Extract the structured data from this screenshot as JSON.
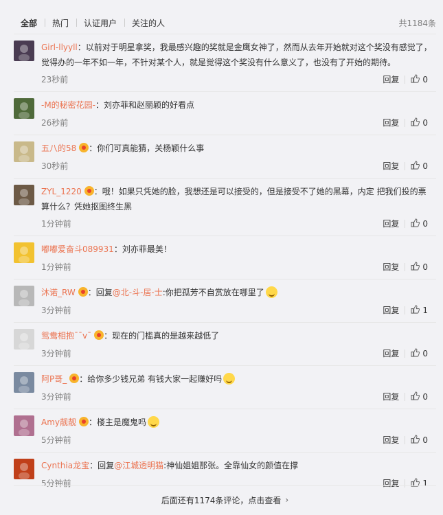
{
  "tabs": [
    "全部",
    "热门",
    "认证用户",
    "关注的人"
  ],
  "total": "共1184条",
  "actions": {
    "reply": "回复"
  },
  "comments": [
    {
      "user": "Girl-llyyll",
      "badge": false,
      "text": "：以前对于明星拿奖，我最感兴趣的奖就是金鹰女神了，然而从去年开始就对这个奖没有感觉了，觉得办的一年不如一年，不针对某个人，就是觉得这个奖没有什么意义了，也没有了开始的期待。",
      "time": "23秒前",
      "likes": "0",
      "avatar_color": "#4a3c52"
    },
    {
      "user": "-M的秘密花园-",
      "badge": false,
      "text": "：刘亦菲和赵丽颖的好看点",
      "time": "26秒前",
      "likes": "0",
      "avatar_color": "#4f6a3a"
    },
    {
      "user": "五八的58",
      "badge": true,
      "text": "：你们可真能猜，关杨颖什么事",
      "time": "30秒前",
      "likes": "0",
      "avatar_color": "#c9b98a"
    },
    {
      "user": "ZYL_1220",
      "badge": true,
      "text": "：哦！如果只凭她的脸，我想还是可以接受的，但是接受不了她的黑幕，内定 把我们投的票算什么？凭她抠图终生黑",
      "time": "1分钟前",
      "likes": "0",
      "avatar_color": "#6d5a46"
    },
    {
      "user": "嘟嘟爱奋斗089931",
      "badge": false,
      "text": "：刘亦菲最美！",
      "time": "1分钟前",
      "likes": "0",
      "avatar_color": "#f2c230"
    },
    {
      "user": "沐诺_RW",
      "badge": true,
      "reply_prefix": "：回复",
      "mention": "@北-斗-居-士",
      "text": ":你把孤芳不自赏放在哪里了",
      "emoji": "eyes-emoji",
      "time": "3分钟前",
      "likes": "1",
      "avatar_color": "#b8b8b8"
    },
    {
      "user": "鸳鸯相抱ˉˉv¯",
      "badge": true,
      "text": "：现在的门槛真的是越来越低了",
      "time": "3分钟前",
      "likes": "0",
      "avatar_color": "#d7d7d7"
    },
    {
      "user": "阿P哥_",
      "badge": true,
      "text": "：给你多少钱兄弟 有钱大家一起赚好吗",
      "emoji": "smile-emoji",
      "time": "3分钟前",
      "likes": "0",
      "avatar_color": "#7a8aa0"
    },
    {
      "user": "Amy靓靓",
      "badge": true,
      "text": "：楼主是魔鬼吗",
      "emoji": "laugh-emoji",
      "time": "5分钟前",
      "likes": "0",
      "avatar_color": "#b07090"
    },
    {
      "user": "Cynthia龙宝",
      "badge": false,
      "reply_prefix": "：回复",
      "mention": "@江城透明猫",
      "text": ":神仙姐姐那张。全靠仙女的颜值在撑",
      "time": "5分钟前",
      "likes": "1",
      "avatar_color": "#c0401a"
    }
  ],
  "more": "后面还有1174条评论，点击查看",
  "colors": {
    "accent": "#eb7350",
    "muted": "#808080",
    "bg": "#f2f2f5"
  }
}
